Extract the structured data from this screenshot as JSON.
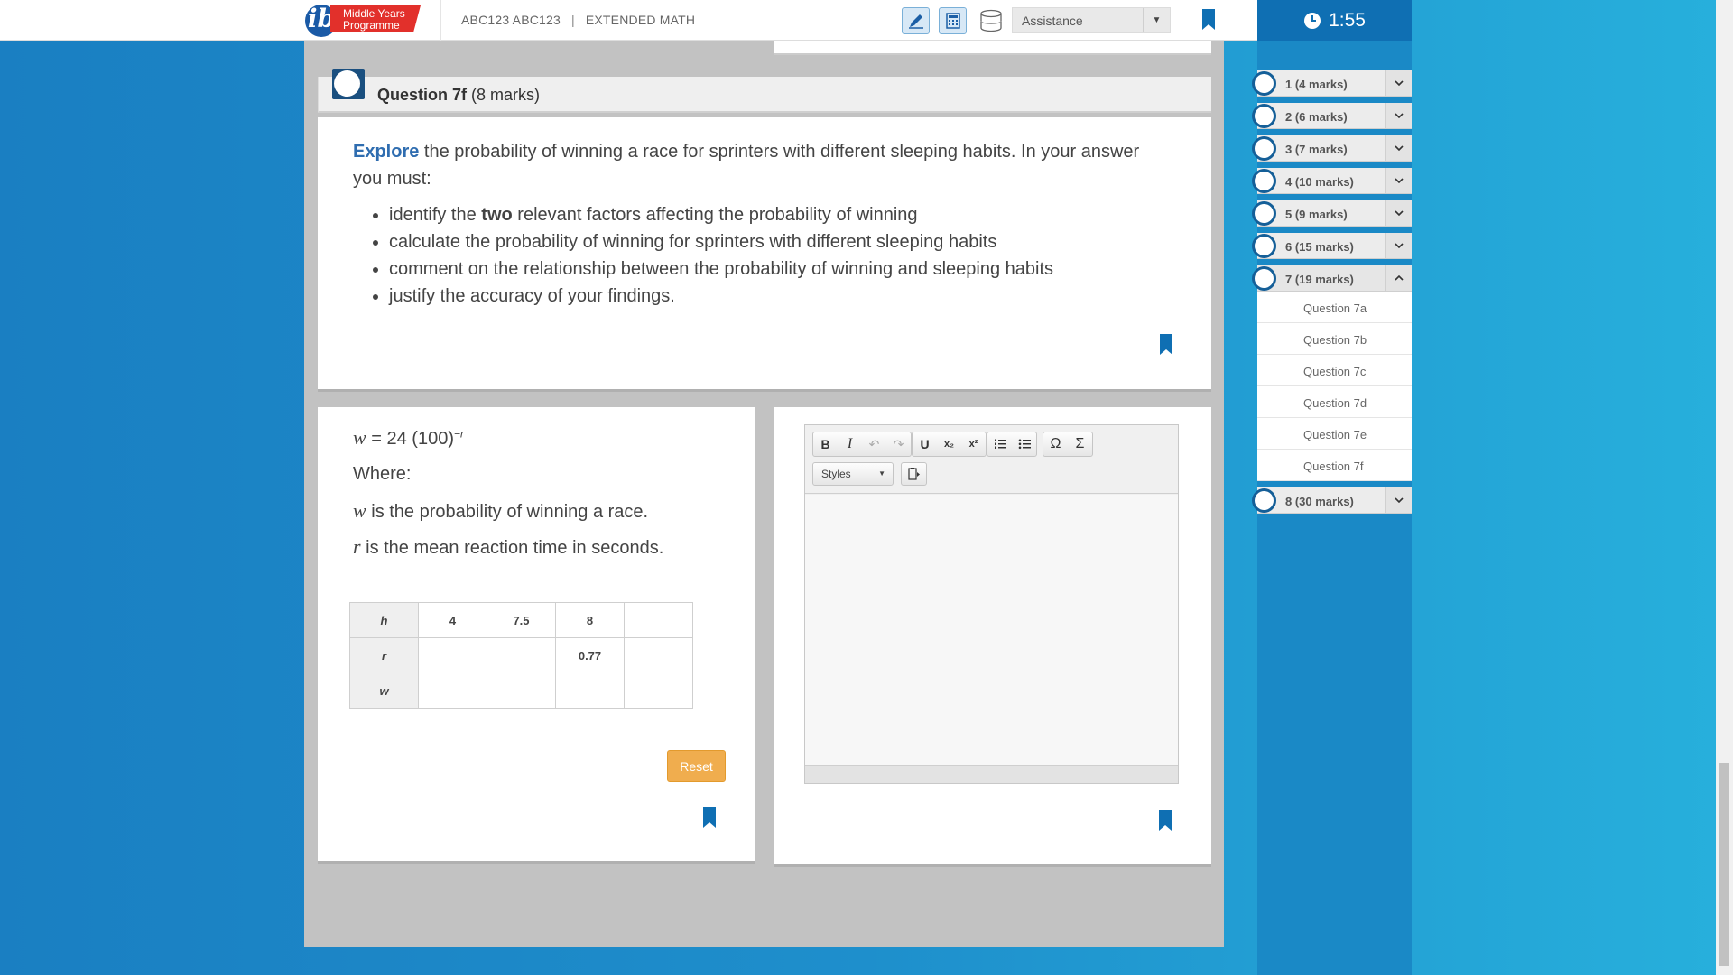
{
  "header": {
    "logo_line1": "Middle Years",
    "logo_line2": "Programme",
    "course_code": "ABC123 ABC123",
    "course_sep": "|",
    "course_name": "EXTENDED MATH",
    "assistance_label": "Assistance"
  },
  "timer": {
    "value": "1:55"
  },
  "question": {
    "number": "Question 7f",
    "marks": "(8 marks)",
    "keyword": "Explore",
    "intro_rest": " the probability of winning a race for sprinters with different sleeping habits. In your answer you must:",
    "bullets": [
      {
        "pre": "identify the ",
        "bold": "two",
        "post": " relevant factors affecting the probability of winning"
      },
      {
        "pre": "calculate the probability of winning for sprinters with different sleeping habits",
        "bold": "",
        "post": ""
      },
      {
        "pre": "comment on the relationship between the probability of winning and sleeping habits",
        "bold": "",
        "post": ""
      },
      {
        "pre": "justify the accuracy of your findings.",
        "bold": "",
        "post": ""
      }
    ]
  },
  "stimulus": {
    "formula_var": "w",
    "formula_body": " = 24 (100)",
    "formula_exp": "−r",
    "where": "Where:",
    "w_var": "w",
    "w_desc": " is the probability of winning a race.",
    "r_var": "r",
    "r_desc": " is the mean reaction time in seconds.",
    "table": [
      [
        "h",
        "4",
        "7.5",
        "8",
        ""
      ],
      [
        "r",
        "",
        "",
        "0.77",
        ""
      ],
      [
        "w",
        "",
        "",
        "",
        ""
      ]
    ],
    "reset_label": "Reset"
  },
  "editor": {
    "bold": "B",
    "italic": "I",
    "underline": "U",
    "subscript": "x₂",
    "superscript": "x²",
    "omega": "Ω",
    "sigma": "Σ",
    "styles_label": "Styles",
    "content": ""
  },
  "nav": {
    "items": [
      {
        "label": "1 (4 marks)",
        "chevron": "down"
      },
      {
        "label": "2 (6 marks)",
        "chevron": "down"
      },
      {
        "label": "3 (7 marks)",
        "chevron": "down"
      },
      {
        "label": "4 (10 marks)",
        "chevron": "down"
      },
      {
        "label": "5 (9 marks)",
        "chevron": "down"
      },
      {
        "label": "6 (15 marks)",
        "chevron": "down"
      },
      {
        "label": "7 (19 marks)",
        "chevron": "up"
      },
      {
        "label": "8 (30 marks)",
        "chevron": "down"
      }
    ],
    "subitems": [
      "Question 7a",
      "Question 7b",
      "Question 7c",
      "Question 7d",
      "Question 7e",
      "Question 7f"
    ]
  },
  "colors": {
    "brand_blue": "#0f6fb3",
    "accent_blue": "#2f6db0",
    "reset_orange": "#f0ad4e",
    "logo_red": "#e2302b"
  },
  "icons": {
    "pen": "pen-icon",
    "calculator": "calculator-icon",
    "cylinder": "formula-sheet-icon",
    "bookmark": "bookmark-icon",
    "clock": "clock-icon"
  }
}
